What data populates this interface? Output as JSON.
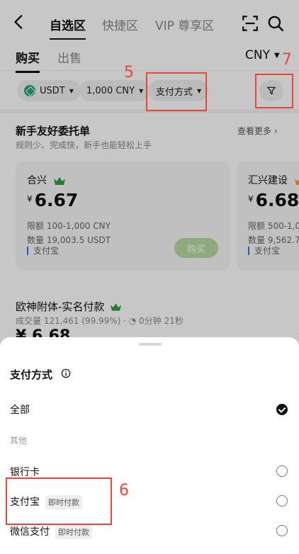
{
  "topnav": {
    "tabs": [
      "自选区",
      "快捷区",
      "VIP 尊享区"
    ],
    "active_tab": 0
  },
  "subnav": {
    "buy_label": "购买",
    "sell_label": "出售",
    "currency": "CNY"
  },
  "filters": {
    "coin": "USDT",
    "amount": "1,000 CNY",
    "payment": "支付方式"
  },
  "annotations": {
    "payment_marker": "5",
    "option_marker": "6",
    "filter_marker": "7"
  },
  "section": {
    "title": "新手友好委托单",
    "subtitle": "规则少、完成快，新手也能轻松上手",
    "see_more": "查看更多 ›"
  },
  "cards": [
    {
      "name": "合兴",
      "currency_sign": "¥",
      "price": "6.67",
      "limit": "限额 100-1,000 CNY",
      "quantity": "数量 19,003.5 USDT",
      "payment": "支付宝",
      "buy_label": "购买"
    },
    {
      "name": "汇兴建设",
      "currency_sign": "¥",
      "price": "6.68",
      "limit": "限额 500-1,0",
      "quantity": "数量 9,562.7",
      "payment": "支付宝"
    }
  ],
  "merchant": {
    "name": "欧神附体-实名付款",
    "stats": "成交量 121,461 (99.99%) · ◔ 0分钟 21秒",
    "price": "¥ 6.68"
  },
  "sheet": {
    "title": "支付方式",
    "options_all": "全部",
    "group_other": "其他",
    "options": [
      {
        "label": "银行卡",
        "tag": ""
      },
      {
        "label": "支付宝",
        "tag": "即时付款"
      },
      {
        "label": "微信支付",
        "tag": "即时付款"
      }
    ]
  },
  "colors": {
    "accent_annotation": "#e8453c",
    "buy_button": "#b8dba0",
    "usdt": "#26a17b",
    "crown": "#2e9e3e"
  }
}
